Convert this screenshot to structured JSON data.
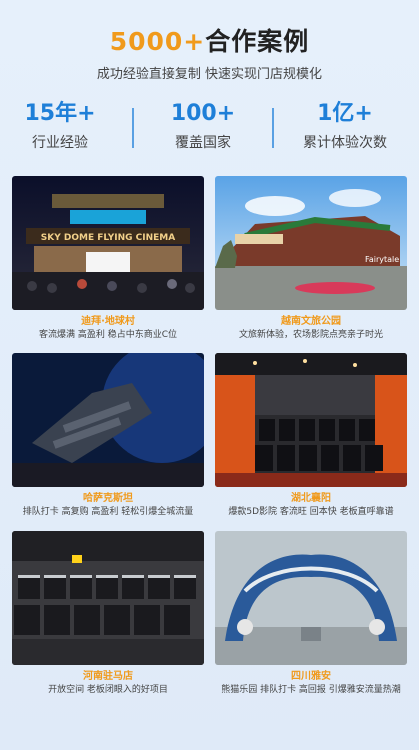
{
  "header": {
    "title_accent": "5000+",
    "title_rest": "合作案例",
    "subtitle": "成功经验直接复制 快速实现门店规模化"
  },
  "stats": [
    {
      "value": "15年+",
      "label": "行业经验"
    },
    {
      "value": "100+",
      "label": "覆盖国家"
    },
    {
      "value": "1亿+",
      "label": "累计体验次数"
    }
  ],
  "photo_signs": {
    "dubai_sign": "SKY DOME FLYING CINEMA",
    "yunnan_sign": "Fairytale"
  },
  "cases": [
    {
      "title": "迪拜·地球村",
      "desc": "客流爆满 高盈利 稳占中东商业C位"
    },
    {
      "title": "越南文旅公园",
      "desc": "文旅新体验，农场影院点亮亲子时光"
    },
    {
      "title": "哈萨克斯坦",
      "desc": "排队打卡 高复购 高盈利 轻松引爆全城流量"
    },
    {
      "title": "湖北襄阳",
      "desc": "爆款5D影院 客流旺 回本快 老板直呼靠谱"
    },
    {
      "title": "河南驻马店",
      "desc": "开放空间 老板闭眼入的好项目"
    },
    {
      "title": "四川雅安",
      "desc": "熊猫乐园 排队打卡 高回报 引爆雅安流量热潮"
    }
  ]
}
